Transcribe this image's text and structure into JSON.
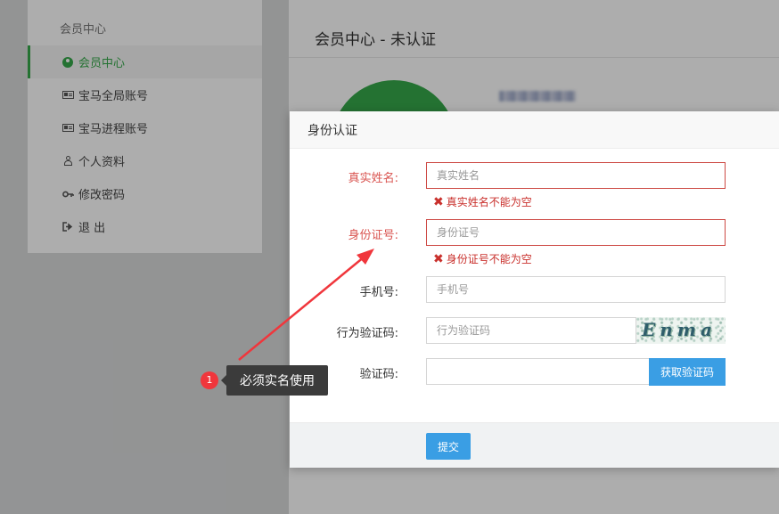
{
  "sidebar": {
    "title": "会员中心",
    "items": [
      {
        "label": "会员中心",
        "icon": "user-circle-icon"
      },
      {
        "label": "宝马全局账号",
        "icon": "id-card-icon"
      },
      {
        "label": "宝马进程账号",
        "icon": "id-card-icon"
      },
      {
        "label": "个人资料",
        "icon": "user-icon"
      },
      {
        "label": "修改密码",
        "icon": "key-icon"
      },
      {
        "label": "退 出",
        "icon": "logout-icon"
      }
    ]
  },
  "main": {
    "title": "会员中心 - 未认证"
  },
  "modal": {
    "title": "身份认证",
    "fields": {
      "real_name": {
        "label": "真实姓名:",
        "placeholder": "真实姓名",
        "error": "真实姓名不能为空"
      },
      "id_number": {
        "label": "身份证号:",
        "placeholder": "身份证号",
        "error": "身份证号不能为空"
      },
      "phone": {
        "label": "手机号:",
        "placeholder": "手机号"
      },
      "captcha": {
        "label": "行为验证码:",
        "placeholder": "行为验证码",
        "image_text": "Enma"
      },
      "sms_code": {
        "label": "验证码:",
        "button": "获取验证码"
      }
    },
    "submit_label": "提交"
  },
  "annotation": {
    "number": "1",
    "text": "必须实名使用"
  },
  "colors": {
    "accent_green": "#36a84a",
    "primary_blue": "#3a9ee4",
    "error_red": "#d9534f",
    "annotation_red": "#f0363c"
  }
}
